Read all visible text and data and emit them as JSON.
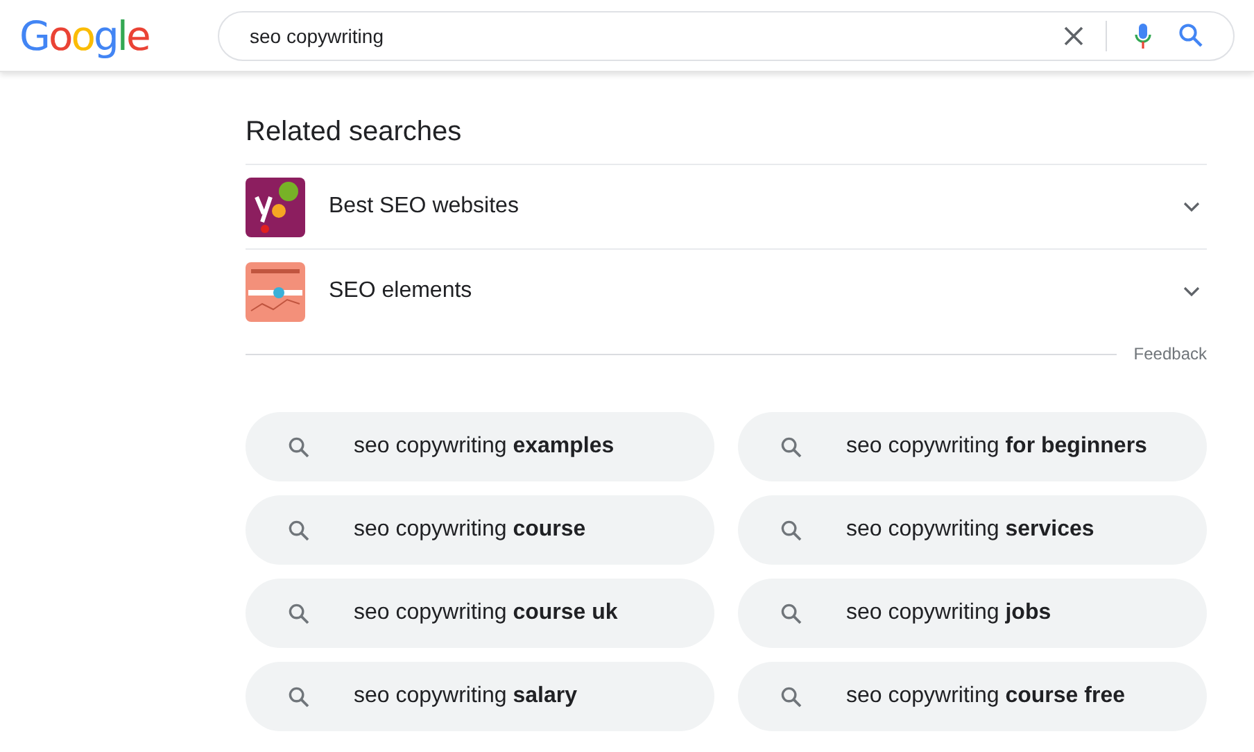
{
  "header": {
    "logo": "Google",
    "search": {
      "value": "seo copywriting"
    }
  },
  "related": {
    "title": "Related searches",
    "items": [
      {
        "kind": "yoast",
        "label": "Best SEO websites",
        "expanded": false
      },
      {
        "kind": "keyword",
        "label": "SEO elements",
        "expanded": false
      }
    ],
    "feedback": "Feedback"
  },
  "suggestions": [
    "seo copywriting **examples**",
    "seo copywriting **for beginners**",
    "seo copywriting **course**",
    "seo copywriting **services**",
    "seo copywriting **course uk**",
    "seo copywriting **jobs**",
    "seo copywriting **salary**",
    "seo copywriting **course free**"
  ]
}
